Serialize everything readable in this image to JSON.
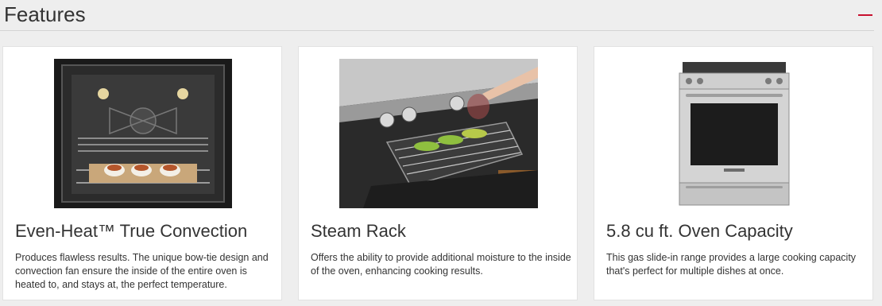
{
  "section": {
    "title": "Features",
    "toggle_icon": "minus-icon",
    "accent_color": "#c8102e"
  },
  "features": [
    {
      "title": "Even-Heat™ True Convection",
      "description": "Produces flawless results. The unique bow-tie design and convection fan ensure the inside of the entire oven is heated to, and stays at, the perfect temperature."
    },
    {
      "title": "Steam Rack",
      "description": "Offers the ability to provide additional moisture to the inside of the oven, enhancing cooking results."
    },
    {
      "title": "5.8 cu ft. Oven Capacity",
      "description": "This gas slide-in range provides a large cooking capacity that's perfect for multiple dishes at once."
    }
  ]
}
